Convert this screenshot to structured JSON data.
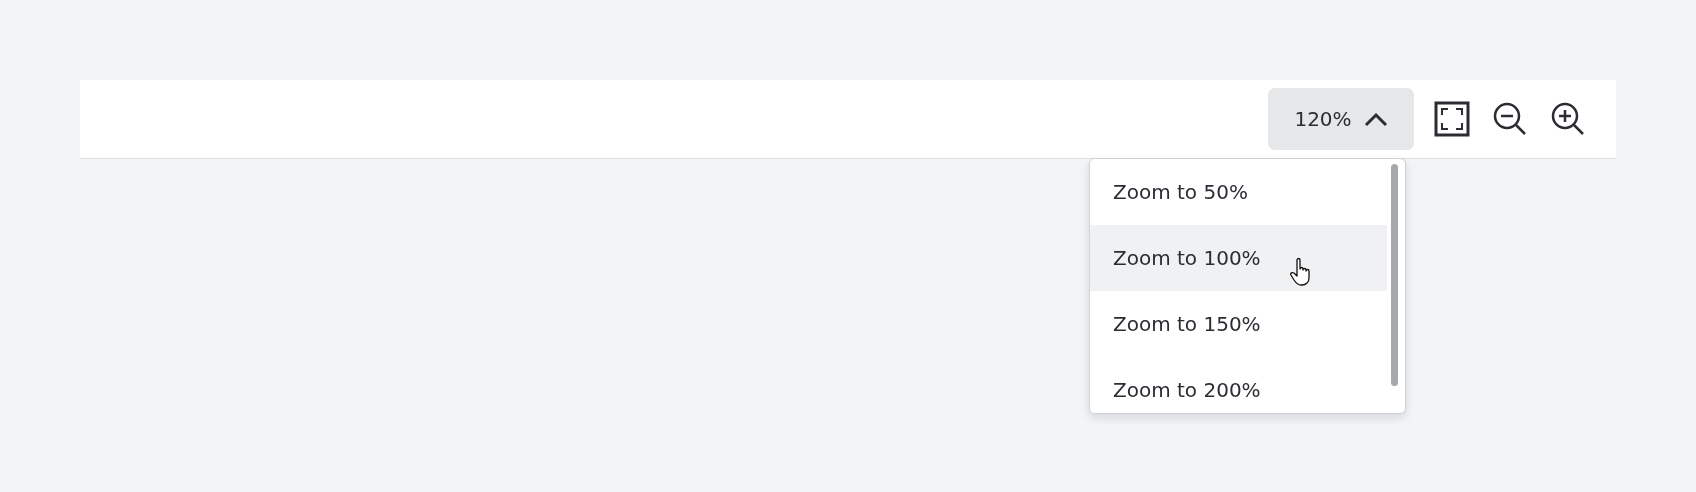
{
  "toolbar": {
    "zoom_button": {
      "label": "120%",
      "expanded": true
    },
    "icons": [
      {
        "kind": "fit"
      },
      {
        "kind": "zoom-out"
      },
      {
        "kind": "zoom-in"
      }
    ]
  },
  "zoom_menu": {
    "items": [
      {
        "label": "Zoom to 50%",
        "highlighted": false
      },
      {
        "label": "Zoom to 100%",
        "highlighted": true
      },
      {
        "label": "Zoom to 150%",
        "highlighted": false
      },
      {
        "label": "Zoom to 200%",
        "highlighted": false
      }
    ]
  }
}
